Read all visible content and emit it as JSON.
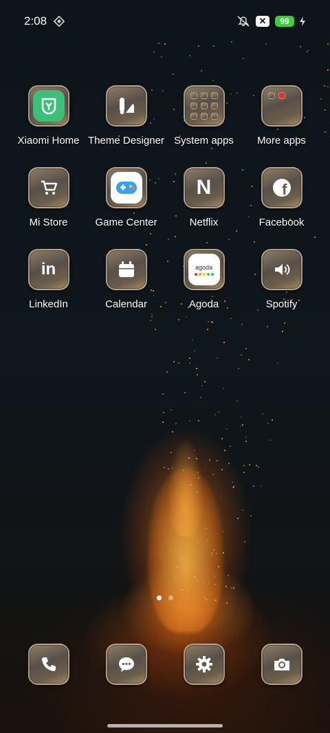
{
  "status_bar": {
    "time": "2:08",
    "battery_level": "99",
    "close_badge": "✕",
    "icons": [
      "diamond-notification-icon",
      "mute-icon",
      "close-badge-icon",
      "battery-icon",
      "charging-icon"
    ]
  },
  "apps": [
    {
      "label": "Xiaomi Home",
      "icon": "xiaomi-home-icon"
    },
    {
      "label": "Theme Designer",
      "icon": "theme-designer-icon"
    },
    {
      "label": "System apps",
      "icon": "folder-icon"
    },
    {
      "label": "More apps",
      "icon": "folder-icon"
    },
    {
      "label": "Mi Store",
      "icon": "cart-icon"
    },
    {
      "label": "Game Center",
      "icon": "gamepad-icon"
    },
    {
      "label": "Netflix",
      "icon": "netflix-icon"
    },
    {
      "label": "Facebook",
      "icon": "facebook-icon"
    },
    {
      "label": "LinkedIn",
      "icon": "linkedin-icon"
    },
    {
      "label": "Calendar",
      "icon": "calendar-icon"
    },
    {
      "label": "Agoda",
      "icon": "agoda-icon"
    },
    {
      "label": "Spotify",
      "icon": "speaker-icon"
    }
  ],
  "icon_text": {
    "netflix": "N",
    "linkedin": "in",
    "facebook": "f",
    "agoda": "agoda"
  },
  "page_indicator": {
    "pages": 2,
    "current": 1
  },
  "dock": [
    {
      "name": "phone",
      "icon": "phone-icon"
    },
    {
      "name": "messages",
      "icon": "message-icon"
    },
    {
      "name": "settings",
      "icon": "gear-icon"
    },
    {
      "name": "camera",
      "icon": "camera-icon"
    }
  ],
  "colors": {
    "battery_green": "#3ccf3c",
    "tile_gold": "#a58a66",
    "xiaomi_green": "#3dbf78",
    "game_blue": "#3aa0f0"
  }
}
